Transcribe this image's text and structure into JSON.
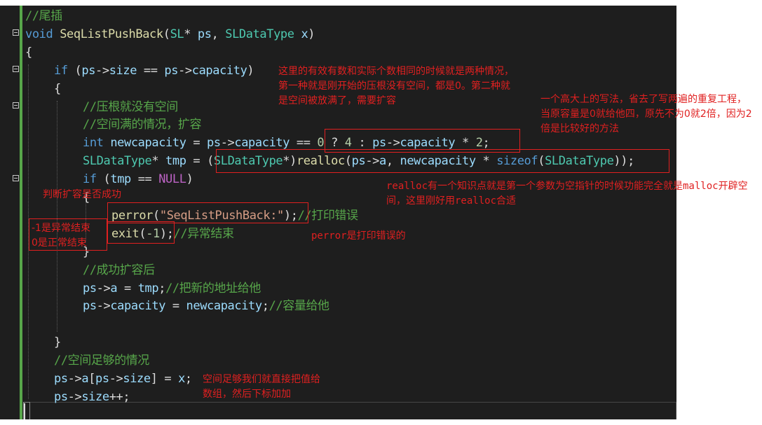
{
  "code": {
    "lines": [
      {
        "indent": 0,
        "spans": [
          {
            "text": "//尾插",
            "cls": "c"
          }
        ]
      },
      {
        "indent": 0,
        "spans": [
          {
            "text": "void ",
            "cls": "k"
          },
          {
            "text": "SeqListPushBack",
            "cls": "f"
          },
          {
            "text": "(",
            "cls": ""
          },
          {
            "text": "SL",
            "cls": "t"
          },
          {
            "text": "* ",
            "cls": ""
          },
          {
            "text": "ps",
            "cls": "p"
          },
          {
            "text": ", ",
            "cls": ""
          },
          {
            "text": "SLDataType",
            "cls": "t"
          },
          {
            "text": " ",
            "cls": ""
          },
          {
            "text": "x",
            "cls": "p"
          },
          {
            "text": ")",
            "cls": ""
          }
        ]
      },
      {
        "indent": 0,
        "spans": [
          {
            "text": "{",
            "cls": ""
          }
        ]
      },
      {
        "indent": 1,
        "spans": [
          {
            "text": "if ",
            "cls": "k"
          },
          {
            "text": "(",
            "cls": ""
          },
          {
            "text": "ps",
            "cls": "p"
          },
          {
            "text": "->",
            "cls": ""
          },
          {
            "text": "size",
            "cls": "p"
          },
          {
            "text": " == ",
            "cls": ""
          },
          {
            "text": "ps",
            "cls": "p"
          },
          {
            "text": "->",
            "cls": ""
          },
          {
            "text": "capacity",
            "cls": "p"
          },
          {
            "text": ")",
            "cls": ""
          }
        ]
      },
      {
        "indent": 1,
        "spans": [
          {
            "text": "{",
            "cls": ""
          }
        ]
      },
      {
        "indent": 2,
        "spans": [
          {
            "text": "//压根就没有空间",
            "cls": "c"
          }
        ]
      },
      {
        "indent": 2,
        "spans": [
          {
            "text": "//空间满的情况，扩容",
            "cls": "c"
          }
        ]
      },
      {
        "indent": 2,
        "spans": [
          {
            "text": "int ",
            "cls": "k"
          },
          {
            "text": "newcapacity",
            "cls": "p"
          },
          {
            "text": " = ",
            "cls": ""
          },
          {
            "text": "ps",
            "cls": "p"
          },
          {
            "text": "->",
            "cls": ""
          },
          {
            "text": "capacity",
            "cls": "p"
          },
          {
            "text": " == ",
            "cls": ""
          },
          {
            "text": "0",
            "cls": "n"
          },
          {
            "text": " ? ",
            "cls": ""
          },
          {
            "text": "4",
            "cls": "n"
          },
          {
            "text": " : ",
            "cls": ""
          },
          {
            "text": "ps",
            "cls": "p"
          },
          {
            "text": "->",
            "cls": ""
          },
          {
            "text": "capacity",
            "cls": "p"
          },
          {
            "text": " * ",
            "cls": ""
          },
          {
            "text": "2",
            "cls": "n"
          },
          {
            "text": ";",
            "cls": ""
          }
        ]
      },
      {
        "indent": 2,
        "spans": [
          {
            "text": "SLDataType",
            "cls": "t"
          },
          {
            "text": "* ",
            "cls": ""
          },
          {
            "text": "tmp",
            "cls": "p"
          },
          {
            "text": " = ",
            "cls": ""
          },
          {
            "text": "(",
            "cls": ""
          },
          {
            "text": "SLDataType",
            "cls": "t"
          },
          {
            "text": "*)",
            "cls": ""
          },
          {
            "text": "realloc",
            "cls": "f"
          },
          {
            "text": "(",
            "cls": ""
          },
          {
            "text": "ps",
            "cls": "p"
          },
          {
            "text": "->",
            "cls": ""
          },
          {
            "text": "a",
            "cls": "p"
          },
          {
            "text": ", ",
            "cls": ""
          },
          {
            "text": "newcapacity",
            "cls": "p"
          },
          {
            "text": " * ",
            "cls": ""
          },
          {
            "text": "sizeof",
            "cls": "k"
          },
          {
            "text": "(",
            "cls": ""
          },
          {
            "text": "SLDataType",
            "cls": "t"
          },
          {
            "text": "));",
            "cls": ""
          }
        ]
      },
      {
        "indent": 2,
        "spans": [
          {
            "text": "if ",
            "cls": "k"
          },
          {
            "text": "(",
            "cls": ""
          },
          {
            "text": "tmp",
            "cls": "p"
          },
          {
            "text": " == ",
            "cls": ""
          },
          {
            "text": "NULL",
            "cls": "m"
          },
          {
            "text": ")",
            "cls": ""
          }
        ]
      },
      {
        "indent": 2,
        "spans": [
          {
            "text": "{",
            "cls": ""
          }
        ]
      },
      {
        "indent": 3,
        "spans": [
          {
            "text": "perror",
            "cls": "f"
          },
          {
            "text": "(",
            "cls": ""
          },
          {
            "text": "\"SeqListPushBack:\"",
            "cls": "s"
          },
          {
            "text": ");",
            "cls": ""
          },
          {
            "text": "//打印错误",
            "cls": "c"
          }
        ]
      },
      {
        "indent": 3,
        "spans": [
          {
            "text": "exit",
            "cls": "f"
          },
          {
            "text": "(",
            "cls": ""
          },
          {
            "text": "-1",
            "cls": "n"
          },
          {
            "text": ");",
            "cls": ""
          },
          {
            "text": "//异常结束",
            "cls": "c"
          }
        ]
      },
      {
        "indent": 2,
        "spans": [
          {
            "text": "}",
            "cls": ""
          }
        ]
      },
      {
        "indent": 2,
        "spans": [
          {
            "text": "//成功扩容后",
            "cls": "c"
          }
        ]
      },
      {
        "indent": 2,
        "spans": [
          {
            "text": "ps",
            "cls": "p"
          },
          {
            "text": "->",
            "cls": ""
          },
          {
            "text": "a",
            "cls": "p"
          },
          {
            "text": " = ",
            "cls": ""
          },
          {
            "text": "tmp",
            "cls": "p"
          },
          {
            "text": ";",
            "cls": ""
          },
          {
            "text": "//把新的地址给他",
            "cls": "c"
          }
        ]
      },
      {
        "indent": 2,
        "spans": [
          {
            "text": "ps",
            "cls": "p"
          },
          {
            "text": "->",
            "cls": ""
          },
          {
            "text": "capacity",
            "cls": "p"
          },
          {
            "text": " = ",
            "cls": ""
          },
          {
            "text": "newcapacity",
            "cls": "p"
          },
          {
            "text": ";",
            "cls": ""
          },
          {
            "text": "//容量给他",
            "cls": "c"
          }
        ]
      },
      {
        "indent": 2,
        "spans": []
      },
      {
        "indent": 1,
        "spans": [
          {
            "text": "}",
            "cls": ""
          }
        ]
      },
      {
        "indent": 1,
        "spans": [
          {
            "text": "//空间足够的情况",
            "cls": "c"
          }
        ]
      },
      {
        "indent": 1,
        "spans": [
          {
            "text": "ps",
            "cls": "p"
          },
          {
            "text": "->",
            "cls": ""
          },
          {
            "text": "a",
            "cls": "p"
          },
          {
            "text": "[",
            "cls": ""
          },
          {
            "text": "ps",
            "cls": "p"
          },
          {
            "text": "->",
            "cls": ""
          },
          {
            "text": "size",
            "cls": "p"
          },
          {
            "text": "] = ",
            "cls": ""
          },
          {
            "text": "x",
            "cls": "p"
          },
          {
            "text": ";",
            "cls": ""
          }
        ]
      },
      {
        "indent": 1,
        "spans": [
          {
            "text": "ps",
            "cls": "p"
          },
          {
            "text": "->",
            "cls": ""
          },
          {
            "text": "size",
            "cls": "p"
          },
          {
            "text": "++;",
            "cls": ""
          }
        ]
      },
      {
        "indent": 0,
        "spans": []
      }
    ]
  },
  "annotations": {
    "note_equal": "这里的有效有数和实际个数相同的时候就是两种情况，第一种就是刚开始的压根没有空间，都是0。第二种就是空间被放满了，需要扩容",
    "note_ternary": "一个高大上的写法，省去了写两遍的重复工程，当原容量是0就给他四，原先不为0就2倍，因为2倍是比较好的方法",
    "note_realloc": "realloc有一个知识点就是第一个参数为空指针的时候功能完全就是malloc开辟空间，这里刚好用realloc合适",
    "note_check": "判断扩容是否成功",
    "note_exit": "-1是异常结束\n0是正常结束",
    "note_perror": "perror是打印错误的",
    "note_enough": "空间足够我们就直接把值给数组，然后下标加加"
  },
  "colors": {
    "comment": "#57a64a",
    "keyword": "#569cd6",
    "type": "#4ec9b0",
    "function": "#dcdcaa",
    "string": "#d69d85",
    "number": "#b5cea8",
    "identifier": "#9cdcfe",
    "macro": "#bd63c5",
    "annotation": "#e02020",
    "editor_bg": "#1e1e1e"
  },
  "icons": [
    "fold-minus-icon"
  ]
}
